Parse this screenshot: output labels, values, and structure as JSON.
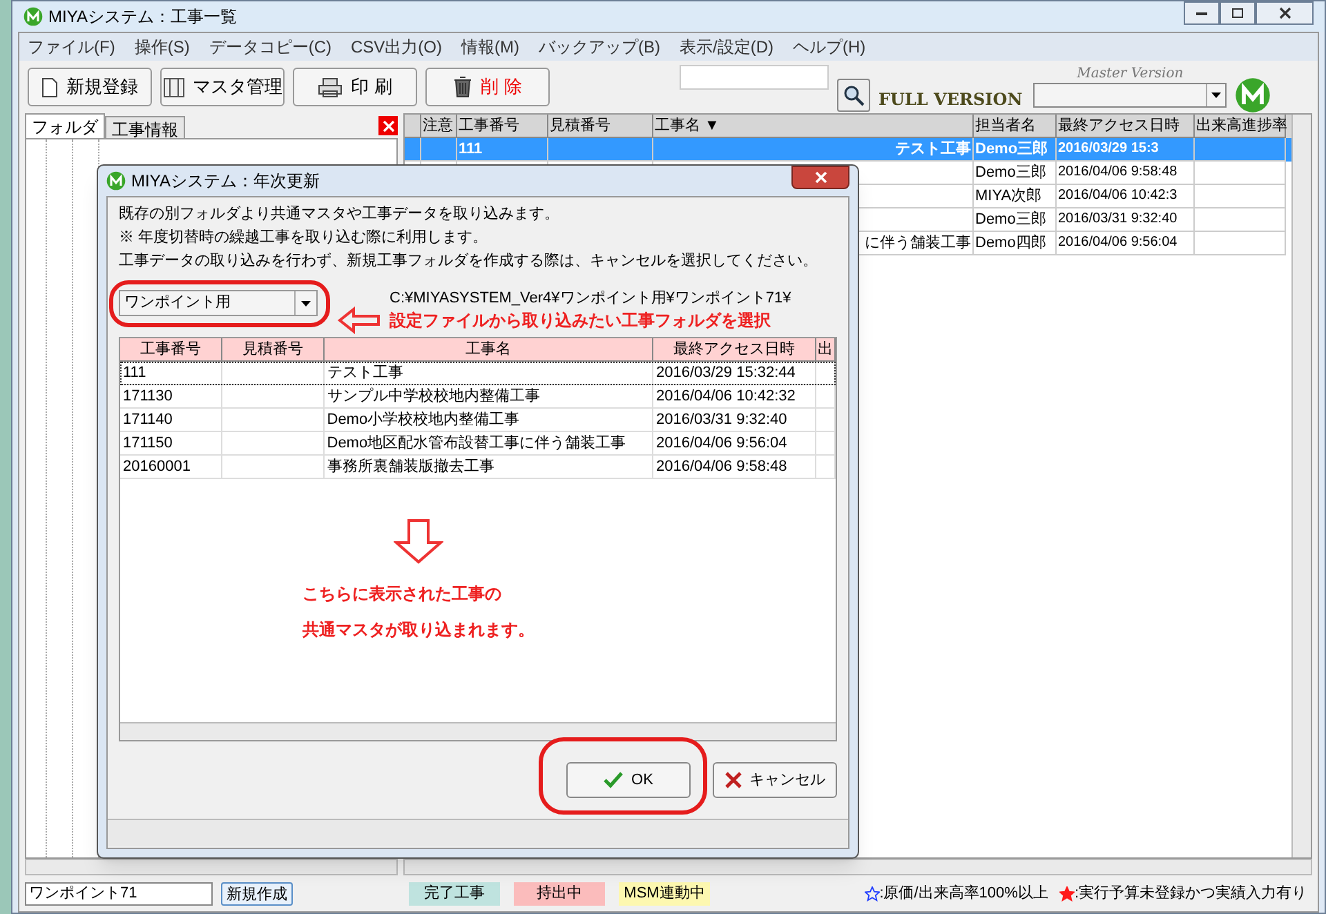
{
  "window": {
    "title": "MIYAシステム：工事一覧"
  },
  "menu": [
    "ファイル(F)",
    "操作(S)",
    "データコピー(C)",
    "CSV出力(O)",
    "情報(M)",
    "バックアップ(B)",
    "表示/設定(D)",
    "ヘルプ(H)"
  ],
  "toolbar": {
    "buttons": [
      {
        "label": "新規登録",
        "kind": "new"
      },
      {
        "label": "マスタ管理",
        "kind": "master"
      },
      {
        "label": "印 刷",
        "kind": "print"
      },
      {
        "label": "削 除",
        "kind": "delete"
      }
    ],
    "edition": "FULL VERSION",
    "edition_note": "Master Version"
  },
  "left_panel": {
    "tabs": [
      {
        "label": "フォルダ",
        "selected": true
      },
      {
        "label": "工事情報",
        "selected": false
      }
    ],
    "folder_name": "ワンポイント71",
    "create_button": "新規作成"
  },
  "grid": {
    "columns": [
      "注意",
      "工事番号",
      "見積番号",
      "工事名 ▼",
      "担当者名",
      "最終アクセス日時",
      "出来高進捗率"
    ],
    "rows": [
      {
        "selected": true,
        "number": "111",
        "name": "テスト工事",
        "person": "Demo三郎",
        "accessed": "2016/03/29 15:3"
      },
      {
        "selected": false,
        "person": "Demo三郎",
        "accessed": "2016/04/06 9:58:48"
      },
      {
        "selected": false,
        "person": "MIYA次郎",
        "accessed": "2016/04/06 10:42:3"
      },
      {
        "selected": false,
        "person": "Demo三郎",
        "accessed": "2016/03/31 9:32:40"
      },
      {
        "selected": false,
        "name": "に伴う舗装工事",
        "person": "Demo四郎",
        "accessed": "2016/04/06 9:56:04"
      }
    ]
  },
  "status_bar": {
    "legends": [
      {
        "label": "完了工事",
        "color": "#bfe3df"
      },
      {
        "label": "持出中",
        "color": "#fbbcbc"
      },
      {
        "label": "MSM連動中",
        "color": "#fdf8b0"
      }
    ],
    "notes": [
      {
        "kind": "outline",
        "color": "#1f3cff",
        "text": ":原価/出来高率100%以上"
      },
      {
        "kind": "filled",
        "color": "#ff1a1a",
        "text": ":実行予算未登録かつ実績入力有り"
      }
    ]
  },
  "dialog": {
    "title": "MIYAシステム：年次更新",
    "lines": [
      "既存の別フォルダより共通マスタや工事データを取り込みます。",
      "※ 年度切替時の繰越工事を取り込む際に利用します。",
      "工事データの取り込みを行わず、新規工事フォルダを作成する際は、キャンセルを選択してください。"
    ],
    "source": {
      "value": "ワンポイント用"
    },
    "path": "C:¥MIYASYSTEM_Ver4¥ワンポイント用¥ワンポイント71¥",
    "hint": "設定ファイルから取り込みたい工事フォルダを選択",
    "table": {
      "columns": [
        "工事番号",
        "見積番号",
        "工事名",
        "最終アクセス日時",
        "出"
      ],
      "rows": [
        {
          "focused": true,
          "number": "111",
          "name": "テスト工事",
          "accessed": "2016/03/29 15:32:44"
        },
        {
          "focused": false,
          "number": "171130",
          "name": "サンプル中学校校地内整備工事",
          "accessed": "2016/04/06 10:42:32"
        },
        {
          "focused": false,
          "number": "171140",
          "name": "Demo小学校校地内整備工事",
          "accessed": "2016/03/31 9:32:40"
        },
        {
          "focused": false,
          "number": "171150",
          "name": "Demo地区配水管布設替工事に伴う舗装工事",
          "accessed": "2016/04/06 9:56:04"
        },
        {
          "focused": false,
          "number": "20160001",
          "name": "事務所裏舗装版撤去工事",
          "accessed": "2016/04/06 9:58:48"
        }
      ]
    },
    "note": [
      "こちらに表示された工事の",
      "共通マスタが取り込まれます。"
    ],
    "buttons": [
      {
        "label": "OK",
        "kind": "ok"
      },
      {
        "label": "キャンセル",
        "kind": "cancel"
      }
    ]
  }
}
